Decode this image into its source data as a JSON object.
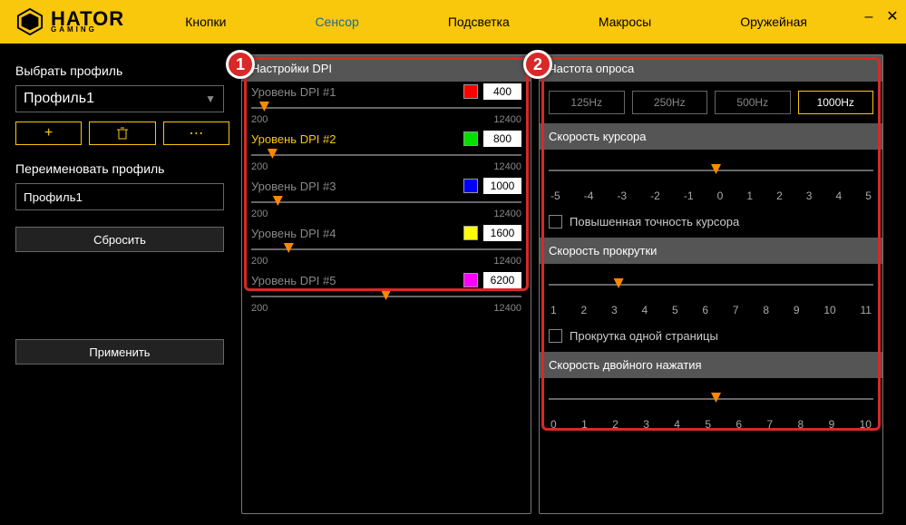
{
  "brand": {
    "name": "HATOR",
    "sub": "GAMING"
  },
  "nav": {
    "buttons": "Кнопки",
    "sensor": "Сенсор",
    "light": "Подсветка",
    "macros": "Макросы",
    "armory": "Оружейная"
  },
  "left": {
    "select_label": "Выбрать профиль",
    "profile": "Профиль1",
    "add": "+",
    "delete": "⧈",
    "more": "⋯",
    "rename_label": "Переименовать профиль",
    "rename_value": "Профиль1",
    "reset": "Сбросить",
    "apply": "Применить"
  },
  "dpi": {
    "header": "Настройки DPI",
    "min": "200",
    "max": "12400",
    "rows": [
      {
        "label": "Уровень DPI #1",
        "color": "#ff0000",
        "value": "400",
        "pos": 3
      },
      {
        "label": "Уровень DPI #2",
        "color": "#00e000",
        "value": "800",
        "pos": 6
      },
      {
        "label": "Уровень DPI #3",
        "color": "#0000ff",
        "value": "1000",
        "pos": 8
      },
      {
        "label": "Уровень DPI #4",
        "color": "#ffff00",
        "value": "1600",
        "pos": 12
      },
      {
        "label": "Уровень DPI #5",
        "color": "#ff00ff",
        "value": "6200",
        "pos": 48
      }
    ]
  },
  "right": {
    "poll_header": "Частота опроса",
    "poll": [
      "125Hz",
      "250Hz",
      "500Hz",
      "1000Hz"
    ],
    "poll_active": 3,
    "cursor_speed": {
      "header": "Скорость курсора",
      "ticks": [
        "-5",
        "-4",
        "-3",
        "-2",
        "-1",
        "0",
        "1",
        "2",
        "3",
        "4",
        "5"
      ],
      "pos": 50,
      "check": "Повышенная точность курсора"
    },
    "scroll_speed": {
      "header": "Скорость прокрутки",
      "ticks": [
        "1",
        "2",
        "3",
        "4",
        "5",
        "6",
        "7",
        "8",
        "9",
        "10",
        "11"
      ],
      "pos": 20,
      "check": "Прокрутка одной страницы"
    },
    "dbl_click": {
      "header": "Скорость двойного нажатия",
      "ticks": [
        "0",
        "1",
        "2",
        "3",
        "4",
        "5",
        "6",
        "7",
        "8",
        "9",
        "10"
      ],
      "pos": 50
    }
  },
  "markers": {
    "m1": "1",
    "m2": "2"
  }
}
